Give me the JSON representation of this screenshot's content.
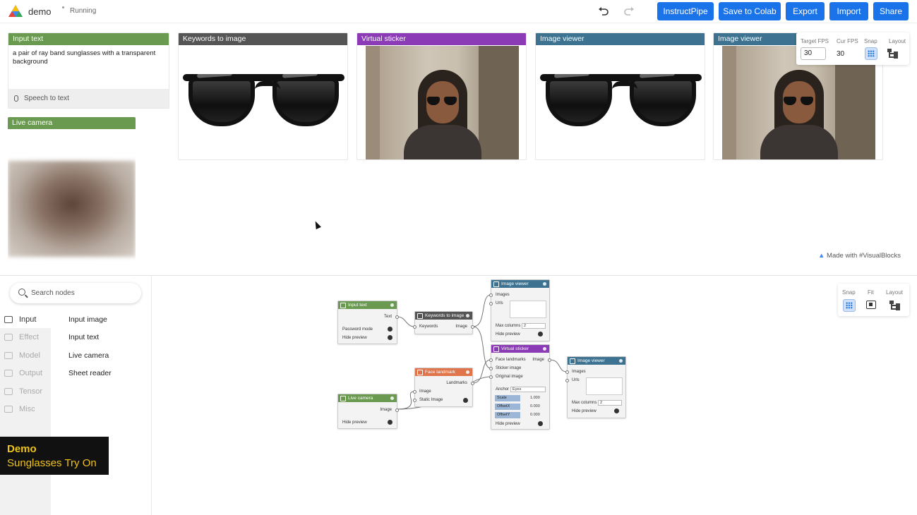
{
  "header": {
    "app_name": "demo",
    "status": "Running",
    "buttons": [
      "InstructPipe",
      "Save to Colab",
      "Export",
      "Import",
      "Share"
    ]
  },
  "colors": {
    "accent": "#1a73e8",
    "green_header": "#6a9a4f",
    "dark_header": "#555555",
    "purple_header": "#8a3bb5",
    "teal_header": "#3d7390",
    "orange_header": "#e0744a"
  },
  "cards": {
    "input_text": {
      "title": "Input text",
      "value": "a pair of ray band sunglasses with a transparent background",
      "speech_label": "Speech to text"
    },
    "live_camera": {
      "title": "Live camera"
    },
    "keywords_to_image": {
      "title": "Keywords to image"
    },
    "virtual_sticker": {
      "title": "Virtual sticker"
    },
    "image_viewer_1": {
      "title": "Image viewer"
    },
    "image_viewer_2": {
      "title": "Image viewer"
    }
  },
  "fps_panel": {
    "target_label": "Target FPS",
    "target_value": "30",
    "cur_label": "Cur FPS",
    "cur_value": "30",
    "snap_label": "Snap",
    "layout_label": "Layout"
  },
  "made_with": "Made with #VisualBlocks",
  "left_panel": {
    "search_placeholder": "Search nodes",
    "categories": [
      "Input",
      "Effect",
      "Model",
      "Output",
      "Tensor",
      "Misc"
    ],
    "nodes": [
      "Input image",
      "Input text",
      "Live camera",
      "Sheet reader"
    ]
  },
  "demo_badge": {
    "line1": "Demo",
    "line2": "Sunglasses Try On"
  },
  "graph_tools": {
    "snap": "Snap",
    "fit": "Fit",
    "layout": "Layout"
  },
  "graph": {
    "input_text": {
      "title": "Input text",
      "out": "Text",
      "password": "Password mode",
      "hide": "Hide preview"
    },
    "live_camera": {
      "title": "Live camera",
      "out": "Image",
      "hide": "Hide preview"
    },
    "keywords": {
      "title": "Keywords to image",
      "in": "Keywords",
      "out": "Image"
    },
    "face_landmark": {
      "title": "Face landmark",
      "out": "Landmarks",
      "in1": "Image",
      "in2": "Static Image"
    },
    "viewer_top": {
      "title": "Image viewer",
      "in1": "Images",
      "in2": "Urls",
      "maxcols": "Max columns",
      "maxcols_val": "2",
      "hide": "Hide preview"
    },
    "sticker": {
      "title": "Virtual sticker",
      "in1": "Face landmarks",
      "in2": "Sticker image",
      "in3": "Original image",
      "out": "Image",
      "anchor": "Anchor",
      "anchor_val": "Eyes",
      "scale": "Scale",
      "scale_val": "1.000",
      "offx": "OffsetX",
      "offx_val": "0.000",
      "offy": "OffsetY",
      "offy_val": "0.000",
      "hide": "Hide preview"
    },
    "viewer_right": {
      "title": "Image viewer",
      "in1": "Images",
      "in2": "Urls",
      "maxcols": "Max columns",
      "maxcols_val": "2",
      "hide": "Hide preview"
    }
  }
}
